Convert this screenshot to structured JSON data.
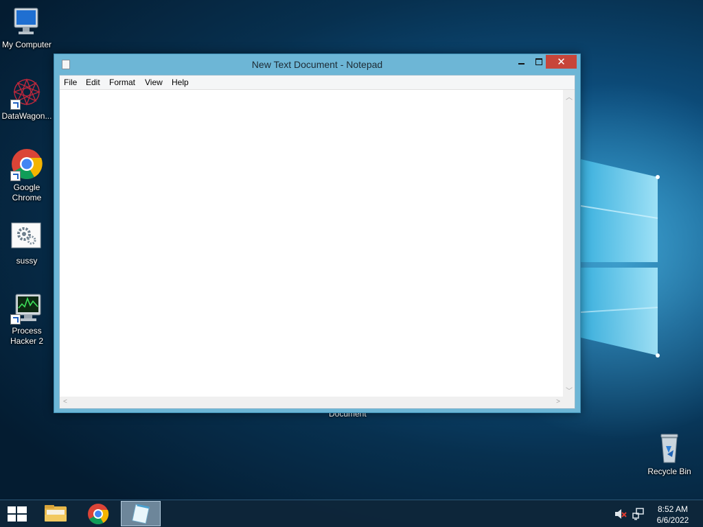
{
  "desktop": {
    "icons": [
      {
        "label": "My Computer"
      },
      {
        "label": "DataWagon..."
      },
      {
        "label_line1": "Google",
        "label_line2": "Chrome"
      },
      {
        "label": "sussy"
      },
      {
        "label_line1": "Process",
        "label_line2": "Hacker 2"
      }
    ],
    "recycle_bin": {
      "label": "Recycle Bin"
    },
    "behind_window_label": "Document"
  },
  "window": {
    "title": "New Text Document - Notepad",
    "close_glyph": "✕",
    "menu": [
      "File",
      "Edit",
      "Format",
      "View",
      "Help"
    ],
    "content": ""
  },
  "taskbar": {
    "time": "8:52 AM",
    "date": "6/6/2022"
  },
  "colors": {
    "window_frame": "#6db6d6",
    "close_button": "#c7453a",
    "taskbar": "#0e263a"
  }
}
